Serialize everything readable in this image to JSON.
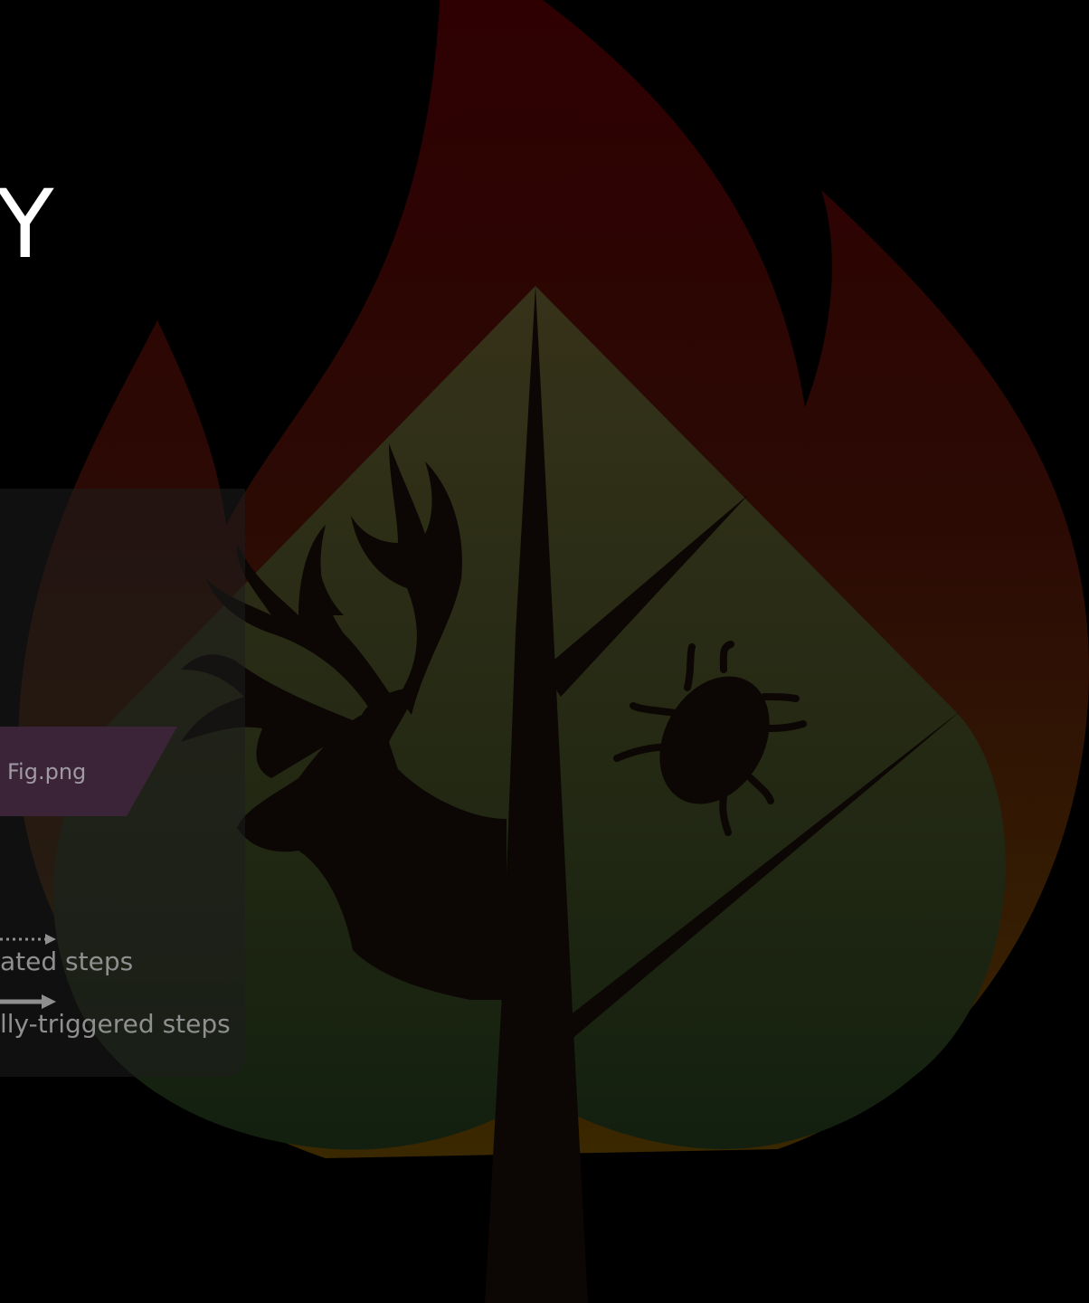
{
  "slide": {
    "title_fragment": "Y"
  },
  "diagram": {
    "file_node_label": "Fig.png",
    "file_node_color": "#3b2438"
  },
  "legend": {
    "items": [
      {
        "label": "ated steps",
        "arrow": "dotted-arrow"
      },
      {
        "label": "lly-triggered steps",
        "arrow": "solid-arrow"
      }
    ]
  },
  "logo": {
    "description_icon": "flame-leaf-logo",
    "icons": [
      "flame-icon",
      "leaf-icon",
      "caribou-icon",
      "beetle-icon",
      "tree-icon"
    ],
    "colors": {
      "flame_top": "#2d0000",
      "flame_bottom": "#3a2800",
      "leaf_top": "#333119",
      "leaf_bottom": "#16200f",
      "silhouette": "#0c0704"
    }
  }
}
